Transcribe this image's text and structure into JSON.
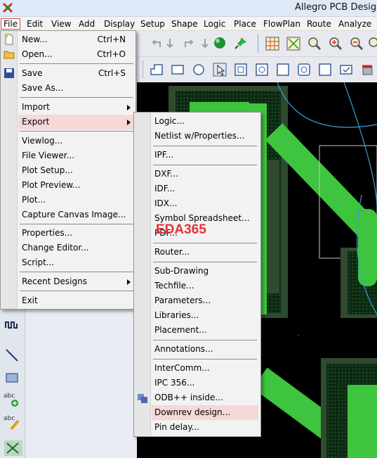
{
  "window": {
    "title": "Allegro PCB Design"
  },
  "menubar": [
    {
      "label": "File",
      "active": true
    },
    {
      "label": "Edit"
    },
    {
      "label": "View"
    },
    {
      "label": "Add"
    },
    {
      "label": "Display"
    },
    {
      "label": "Setup"
    },
    {
      "label": "Shape"
    },
    {
      "label": "Logic"
    },
    {
      "label": "Place"
    },
    {
      "label": "FlowPlan"
    },
    {
      "label": "Route"
    },
    {
      "label": "Analyze"
    }
  ],
  "file_menu": {
    "items": [
      {
        "label": "New...",
        "shortcut": "Ctrl+N"
      },
      {
        "label": "Open...",
        "shortcut": "Ctrl+O"
      },
      {
        "label": "Save",
        "shortcut": "Ctrl+S"
      },
      {
        "label": "Save As..."
      },
      {
        "label": "Import"
      },
      {
        "label": "Export"
      },
      {
        "label": "Viewlog..."
      },
      {
        "label": "File Viewer..."
      },
      {
        "label": "Plot Setup..."
      },
      {
        "label": "Plot Preview..."
      },
      {
        "label": "Plot..."
      },
      {
        "label": "Capture Canvas Image..."
      },
      {
        "label": "Properties..."
      },
      {
        "label": "Change Editor..."
      },
      {
        "label": "Script..."
      },
      {
        "label": "Recent Designs"
      },
      {
        "label": "Exit"
      }
    ]
  },
  "export_menu": {
    "items": [
      {
        "label": "Logic..."
      },
      {
        "label": "Netlist w/Properties..."
      },
      {
        "label": "IPF..."
      },
      {
        "label": "DXF..."
      },
      {
        "label": "IDF..."
      },
      {
        "label": "IDX..."
      },
      {
        "label": "Symbol Spreadsheet..."
      },
      {
        "label": "PDF..."
      },
      {
        "label": "Router..."
      },
      {
        "label": "Sub-Drawing"
      },
      {
        "label": "Techfile..."
      },
      {
        "label": "Parameters..."
      },
      {
        "label": "Libraries..."
      },
      {
        "label": "Placement..."
      },
      {
        "label": "Annotations..."
      },
      {
        "label": "InterComm..."
      },
      {
        "label": "IPC 356..."
      },
      {
        "label": "ODB++ inside..."
      },
      {
        "label": "Downrev design..."
      },
      {
        "label": "Pin delay..."
      }
    ]
  },
  "watermark": "EDA365",
  "colors": {
    "highlight": "#f5d8d8",
    "canvas": "#000000",
    "etch": "#3ec43e",
    "file_border": "#d24c4c"
  }
}
